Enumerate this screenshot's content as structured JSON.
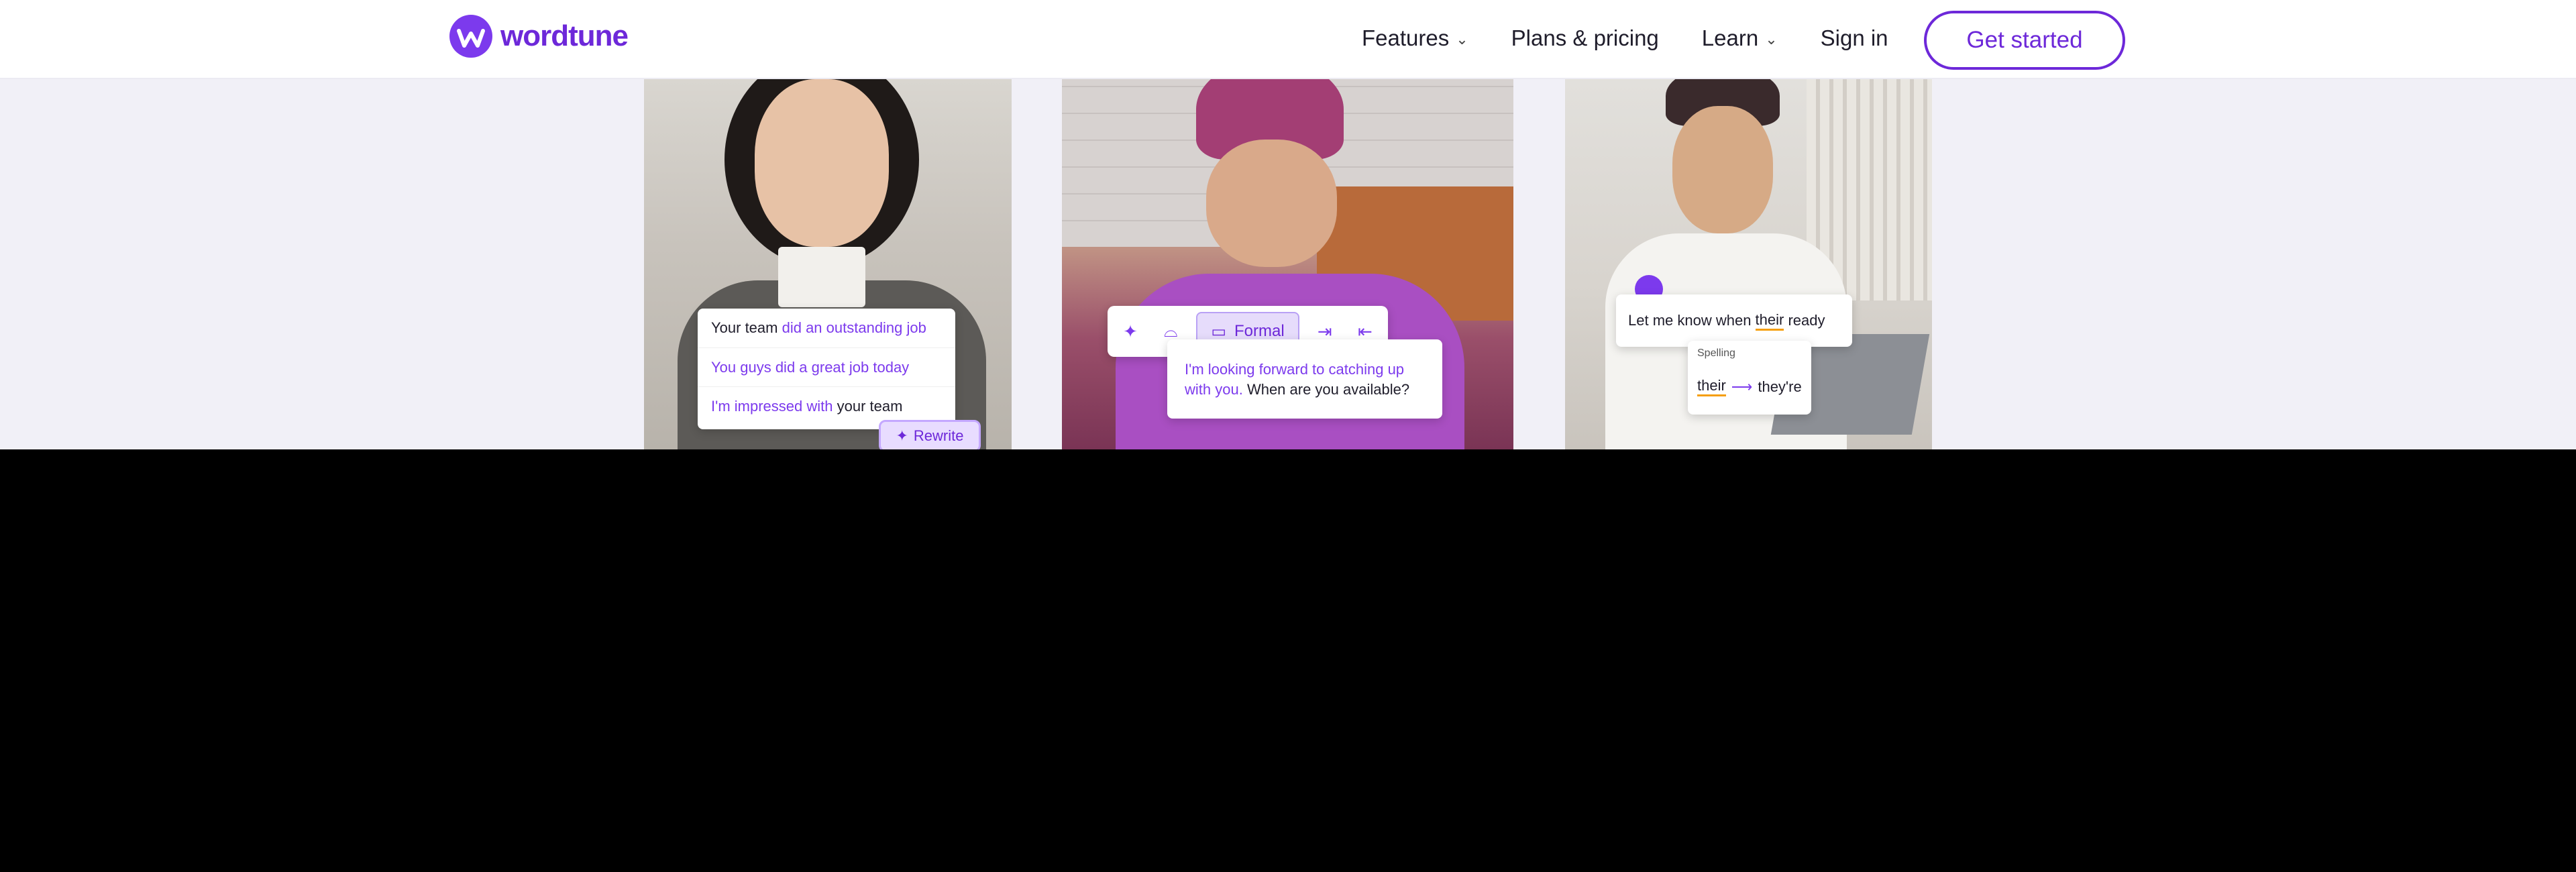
{
  "brand": {
    "name": "wordtune",
    "accent": "#6d28d9"
  },
  "nav": {
    "features": "Features",
    "pricing": "Plans & pricing",
    "learn": "Learn",
    "signin": "Sign in",
    "cta": "Get started"
  },
  "card1": {
    "line1_plain": "Your team ",
    "line1_suggestion": "did an outstanding job",
    "line2": "You guys did a great job today",
    "line3_suggestion": "I'm impressed with ",
    "line3_plain": "your team",
    "rewrite": "Rewrite"
  },
  "card2": {
    "formal": "Formal",
    "text_suggestion": "I'm looking forward to catching up with you.",
    "text_plain": " When are you available?"
  },
  "card3": {
    "sentence_before": "Let me know when ",
    "sentence_word": "their",
    "sentence_after": " ready",
    "spelling_label": "Spelling",
    "wrong": "their",
    "arrow": "⟶",
    "right": "they're"
  }
}
